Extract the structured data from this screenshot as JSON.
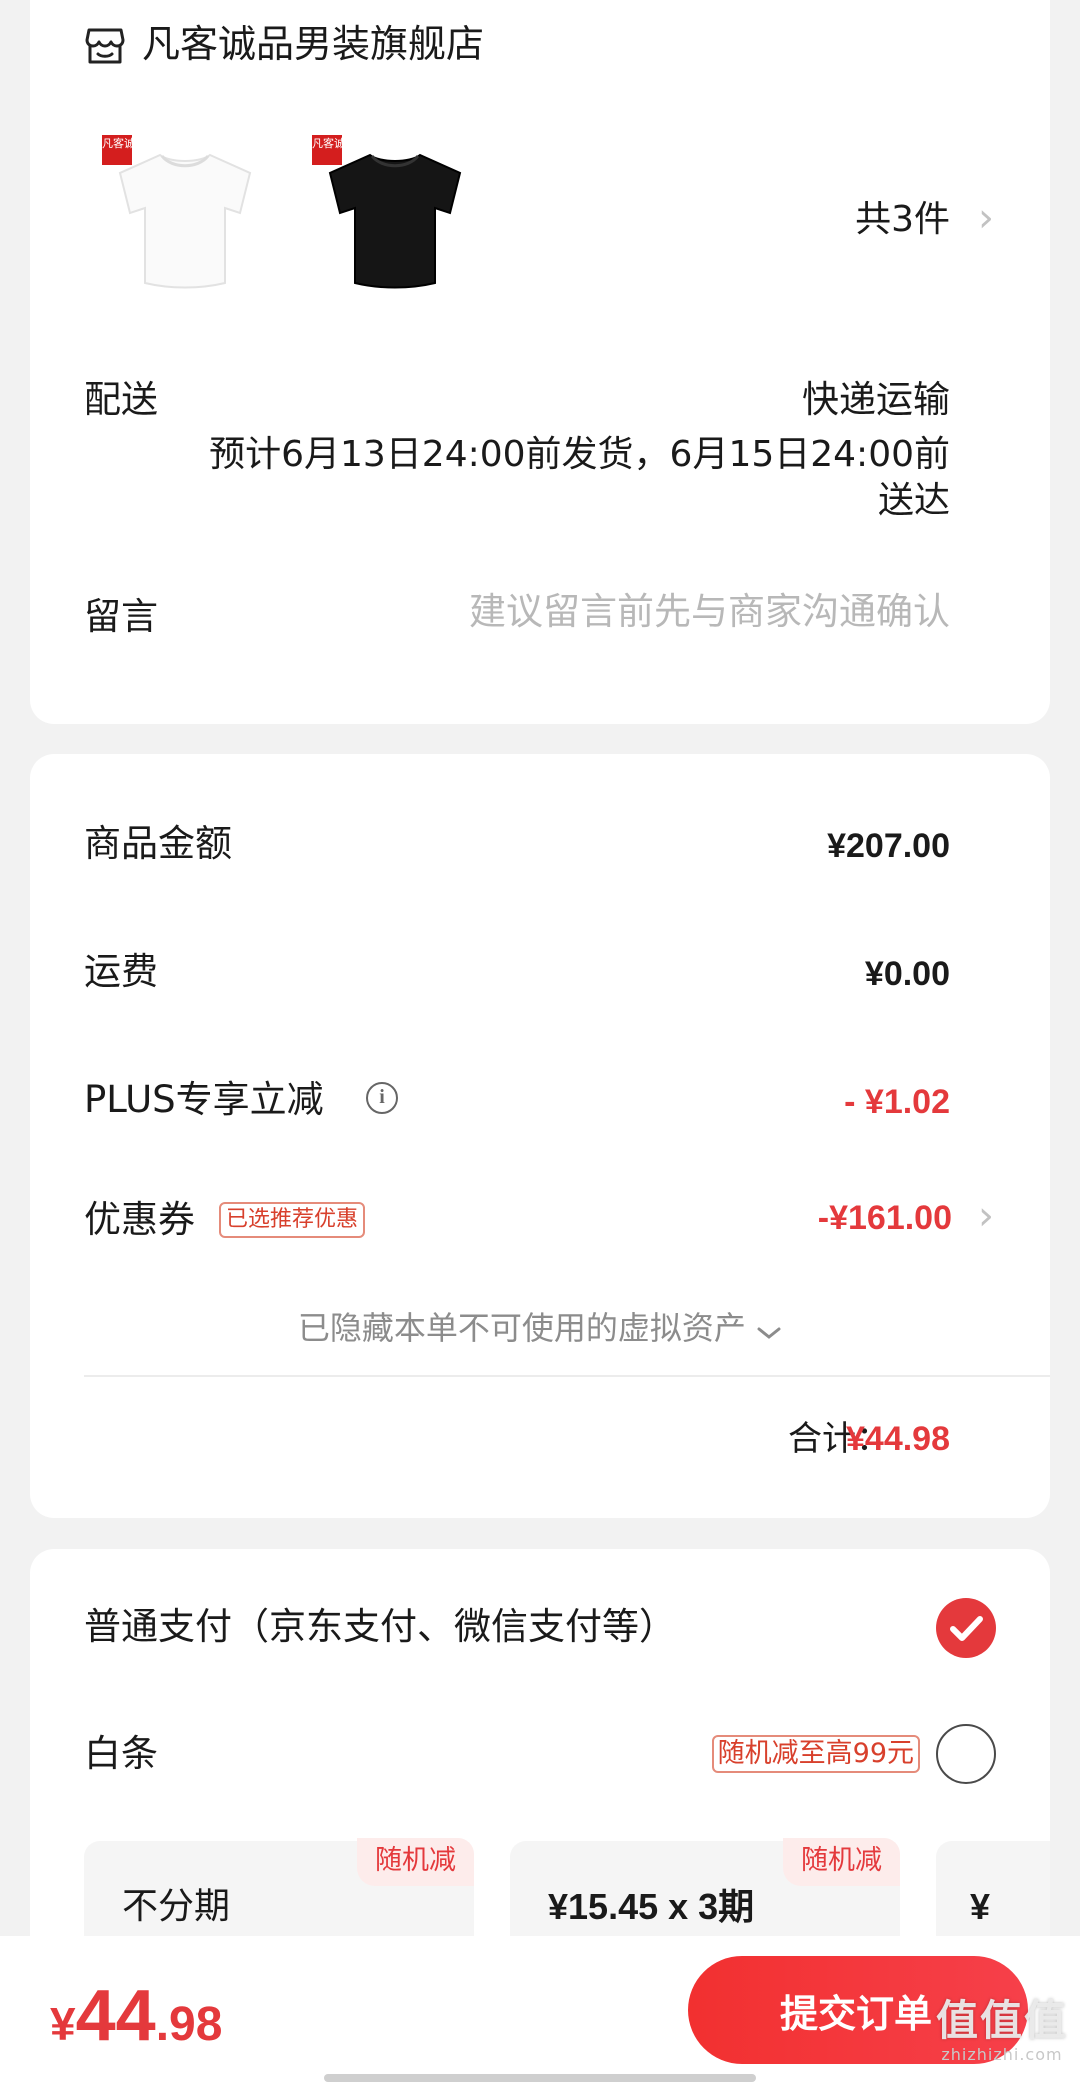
{
  "store": {
    "name": "凡客诚品男装旗舰店",
    "icon": "store-icon",
    "products": [
      {
        "badge": "凡客诚品",
        "color": "white"
      },
      {
        "badge": "凡客诚品",
        "color": "black"
      }
    ],
    "count": "共3件",
    "delivery_label": "配送",
    "delivery_mode": "快递运输",
    "delivery_estimate": "预计6月13日24:00前发货，6月15日24:00前送达",
    "message_label": "留言",
    "message_placeholder": "建议留言前先与商家沟通确认"
  },
  "pricing": {
    "goods_label": "商品金额",
    "goods_value": "¥207.00",
    "shipping_label": "运费",
    "shipping_value": "¥0.00",
    "plus_label": "PLUS专享立减",
    "plus_value": "- ¥1.02",
    "coupon_label": "优惠券",
    "coupon_tag": "已选推荐优惠",
    "coupon_value": "-¥161.00",
    "hidden_assets": "已隐藏本单不可使用的虚拟资产",
    "total_label": "合计：",
    "total_value": "¥44.98",
    "accent_color": "#e4393c"
  },
  "payment": {
    "normal_label": "普通支付（京东支付、微信支付等）",
    "normal_selected": true,
    "baitiao_label": "白条",
    "baitiao_tag": "随机减至高99元",
    "baitiao_selected": false,
    "installments": [
      {
        "title": "不分期",
        "tag": "随机减"
      },
      {
        "title": "¥15.45 x 3期",
        "tag": "随机减"
      },
      {
        "title": "¥",
        "tag": ""
      }
    ]
  },
  "bottom": {
    "price_currency": "¥",
    "price_integer": "44",
    "price_decimal": ".98",
    "submit_label": "提交订单",
    "watermark": "值值值",
    "watermark_sub": "zhizhizhi.com"
  }
}
